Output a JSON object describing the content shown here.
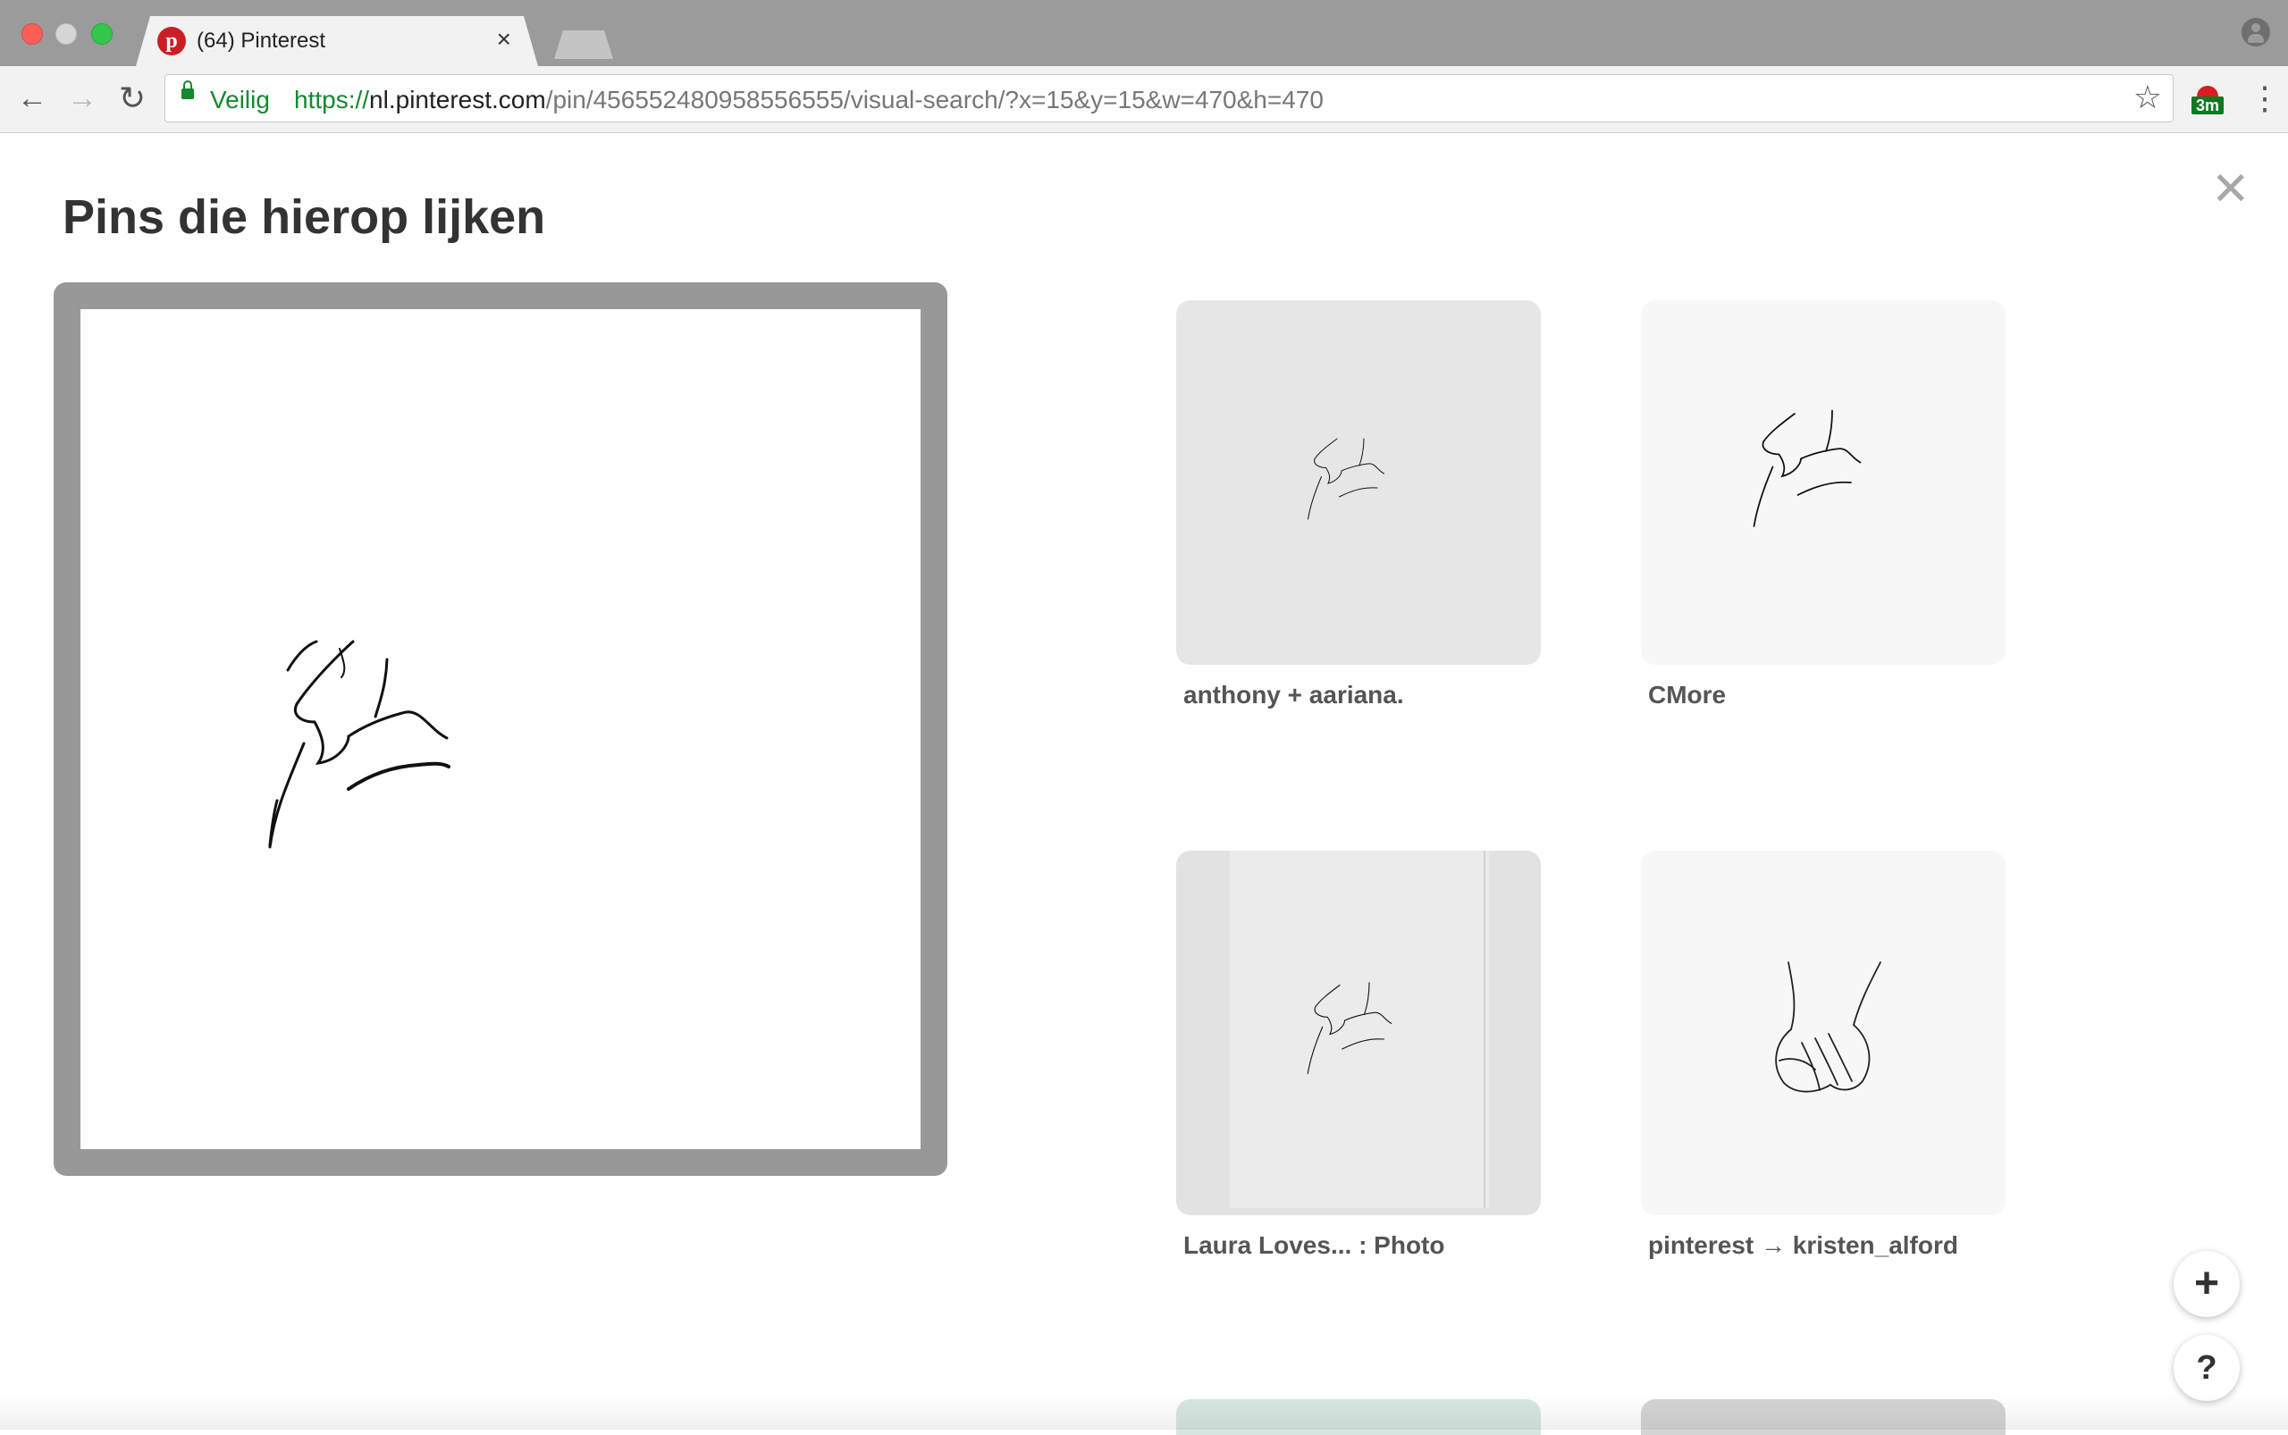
{
  "browser": {
    "tab_title": "(64) Pinterest",
    "tab_close": "×",
    "secure_label": "Veilig",
    "url": {
      "scheme": "https://",
      "host": "nl.pinterest.com",
      "path": "/pin/456552480958556555/visual-search/?x=15&y=15&w=470&h=470"
    },
    "extension_badge": "3m",
    "icons": {
      "back": "arrow-left-icon",
      "forward": "arrow-right-icon",
      "reload": "reload-icon",
      "bookmark": "star-icon",
      "menu": "more-vert-icon",
      "profile": "profile-icon"
    }
  },
  "page": {
    "title": "Pins die hierop lijken",
    "close_symbol": "✕",
    "pins": [
      {
        "title": "anthony + aariana.",
        "bg": "#e6e6e6"
      },
      {
        "title": "CMore",
        "bg": "#f7f7f7"
      },
      {
        "title": "Laura Loves... : Photo",
        "bg": "#e2e2e2"
      },
      {
        "title": "pinterest → kristen_alford",
        "bg": "#f7f7f7"
      }
    ],
    "partial_pin_colors": [
      "#d6e6e0",
      "#d4d4d4"
    ],
    "fab_plus": "+",
    "fab_help": "?"
  },
  "colors": {
    "accent_secure": "#128a2f",
    "pinterest_red": "#cb1f27",
    "frame_gray": "#989898"
  }
}
